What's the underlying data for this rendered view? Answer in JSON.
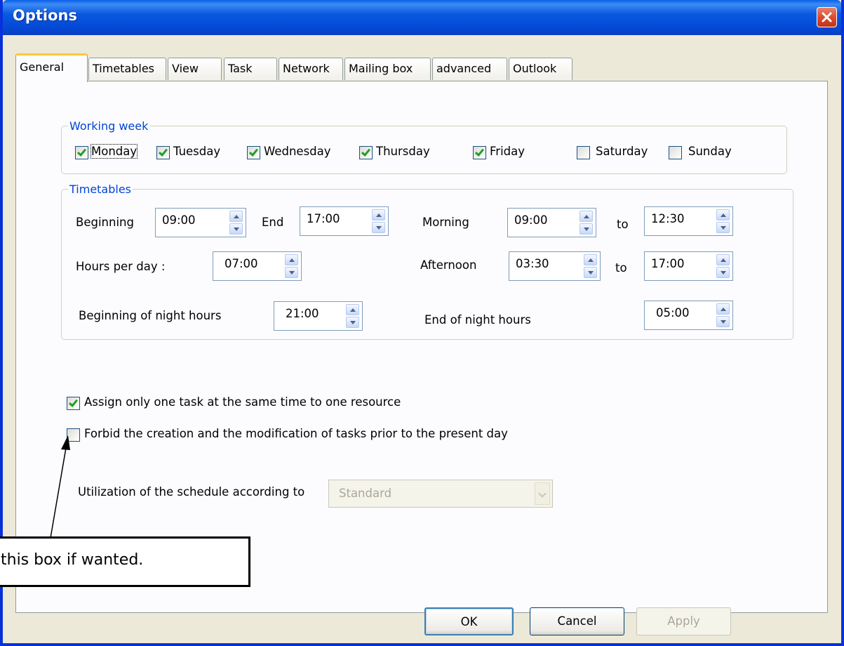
{
  "window": {
    "title": "Options"
  },
  "tabs": [
    "General",
    "Timetables",
    "View",
    "Task",
    "Network",
    "Mailing box",
    "advanced",
    "Outlook"
  ],
  "working_week": {
    "legend": "Working week",
    "days": [
      {
        "label": "Monday",
        "checked": true
      },
      {
        "label": "Tuesday",
        "checked": true
      },
      {
        "label": "Wednesday",
        "checked": true
      },
      {
        "label": "Thursday",
        "checked": true
      },
      {
        "label": "Friday",
        "checked": true
      },
      {
        "label": "Saturday",
        "checked": false
      },
      {
        "label": "Sunday",
        "checked": false
      }
    ]
  },
  "timetables": {
    "legend": "Timetables",
    "beginning_label": "Beginning",
    "beginning_value": "09:00",
    "end_label": "End",
    "end_value": "17:00",
    "morning_label": "Morning",
    "morning_from": "09:00",
    "to_label": "to",
    "morning_to": "12:30",
    "hours_per_day_label": "Hours per day :",
    "hours_per_day_value": "07:00",
    "afternoon_label": "Afternoon",
    "afternoon_from": "03:30",
    "afternoon_to": "17:00",
    "night_begin_label": "Beginning of night hours",
    "night_begin_value": "21:00",
    "night_end_label": "End of night hours",
    "night_end_value": "05:00"
  },
  "options": {
    "assign_one_task_label": "Assign only one task at the same time to one resource",
    "assign_one_task_checked": true,
    "forbid_prior_label": "Forbid the creation and the modification of tasks prior to the present day",
    "forbid_prior_checked": false
  },
  "schedule": {
    "label": "Utilization of the schedule according to",
    "selected": "Standard"
  },
  "callout": {
    "text": "this box if wanted."
  },
  "buttons": {
    "ok": "OK",
    "cancel": "Cancel",
    "apply": "Apply"
  }
}
